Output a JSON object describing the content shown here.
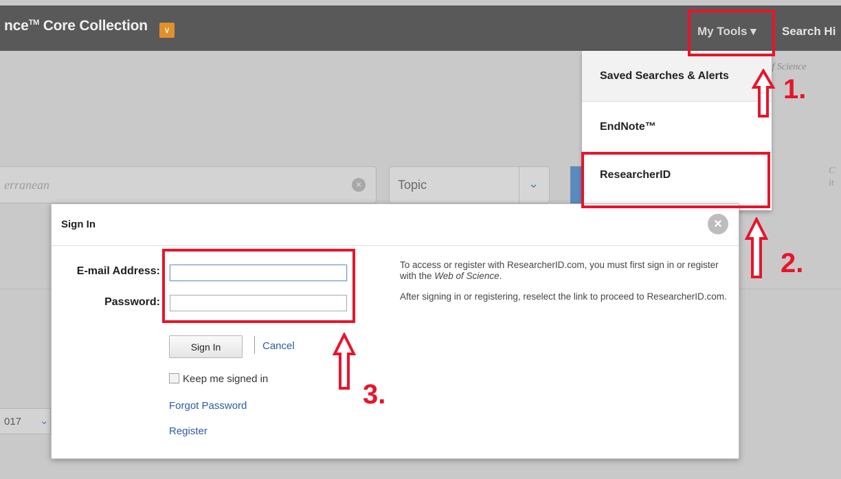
{
  "topbar": {
    "brand_text": "nce",
    "brand_tm": "TM",
    "brand_text2": " Core Collection",
    "brand_dropdown_glyph": "∨",
    "my_tools_label": "My Tools ▾",
    "search_history_label": "Search Hi"
  },
  "background": {
    "wos_link_text": "b of Science",
    "search_placeholder": "erranean",
    "topic_select": "Topic",
    "side_text": "C\nit",
    "year_select": "017"
  },
  "tools_menu": {
    "items": [
      {
        "label": "Saved Searches & Alerts"
      },
      {
        "label": "EndNote™"
      },
      {
        "label": "ResearcherID"
      }
    ]
  },
  "signin_dialog": {
    "title": "Sign In",
    "email_label": "E-mail Address:",
    "email_value": "",
    "password_label": "Password:",
    "password_value": "",
    "signin_button": "Sign In",
    "cancel_link": "Cancel",
    "keep_signed_in_label": "Keep me signed in",
    "keep_signed_in_checked": false,
    "forgot_password_link": "Forgot Password",
    "register_link": "Register",
    "info_p1_a": "To access or register with ResearcherID.com, you must first sign in or register with the ",
    "info_p1_em": "Web of Science",
    "info_p1_b": ".",
    "info_p2": "After signing in or registering, reselect the link to proceed to ResearcherID.com."
  },
  "annotations": {
    "step1": "1.",
    "step2": "2.",
    "step3": "3.",
    "color": "#e8142a"
  },
  "colors": {
    "topbar": "#595959",
    "accent_orange": "#e0902c",
    "link_blue": "#2d5aa0"
  }
}
